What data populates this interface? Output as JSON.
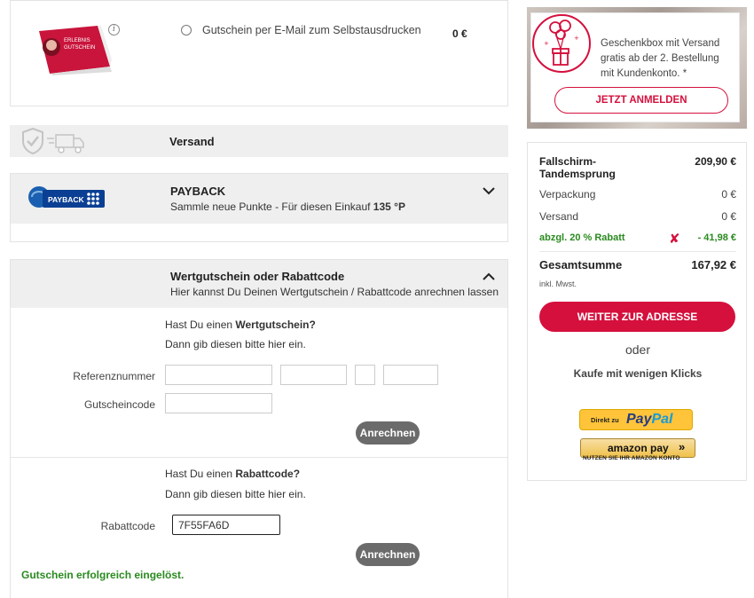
{
  "voucher": {
    "info_icon": "i",
    "option_label": "Gutschein per E-Mail zum Selbstausdrucken",
    "price": "0 €",
    "thumb_text_1": "ERLEBNIS",
    "thumb_text_2": "GUTSCHEIN"
  },
  "shipping": {
    "label": "Versand"
  },
  "payback": {
    "title": "PAYBACK",
    "subtitle_prefix": "Sammle neue Punkte - Für diesen Einkauf ",
    "points": "135 °P",
    "logo_text": "PAYBACK"
  },
  "coupon": {
    "title": "Wertgutschein oder Rabattcode",
    "subtitle": "Hier kannst Du Deinen Wertgutschein / Rabattcode anrechnen lassen",
    "voucher_section": {
      "question_prefix": "Hast Du einen ",
      "question_bold": "Wertgutschein?",
      "hint": "Dann gib diesen bitte hier ein.",
      "ref_label": "Referenznummer",
      "code_label": "Gutscheincode",
      "button": "Anrechnen"
    },
    "discount_section": {
      "question_prefix": "Hast Du einen ",
      "question_bold": "Rabattcode?",
      "hint": "Dann gib diesen bitte hier ein.",
      "code_label": "Rabattcode",
      "code_value": "7F55FA6D",
      "button": "Anrechnen"
    },
    "success_message": "Gutschein erfolgreich eingelöst."
  },
  "promo": {
    "text": "Geschenkbox mit Versand gratis ab der 2. Bestellung mit Kundenkonto. *",
    "button": "JETZT ANMELDEN"
  },
  "summary": {
    "product_name_1": "Fallschirm-",
    "product_name_2": "Tandemsprung",
    "product_price": "209,90 €",
    "packaging_label": "Verpackung",
    "packaging_price": "0 €",
    "shipping_label": "Versand",
    "shipping_price": "0 €",
    "discount_label": "abzgl. 20 % Rabatt",
    "discount_value": "- 41,98 €",
    "remove_icon": "✘",
    "total_label": "Gesamtsumme",
    "total_value": "167,92 €",
    "vat_note": "inkl. Mwst.",
    "continue_button": "WEITER ZUR ADRESSE",
    "or_text": "oder",
    "quick_text": "Kaufe mit wenigen Klicks",
    "paypal_small": "Direkt zu",
    "paypal_word_1": "Pay",
    "paypal_word_2": "Pal",
    "amazon_word": "amazon pay",
    "amazon_arrows": "»",
    "amazon_sub": "NUTZEN SIE IHR AMAZON KONTO"
  },
  "colors": {
    "accent": "#d5103d",
    "success": "#2a8a1f",
    "paypal_yellow": "#ffc439"
  }
}
